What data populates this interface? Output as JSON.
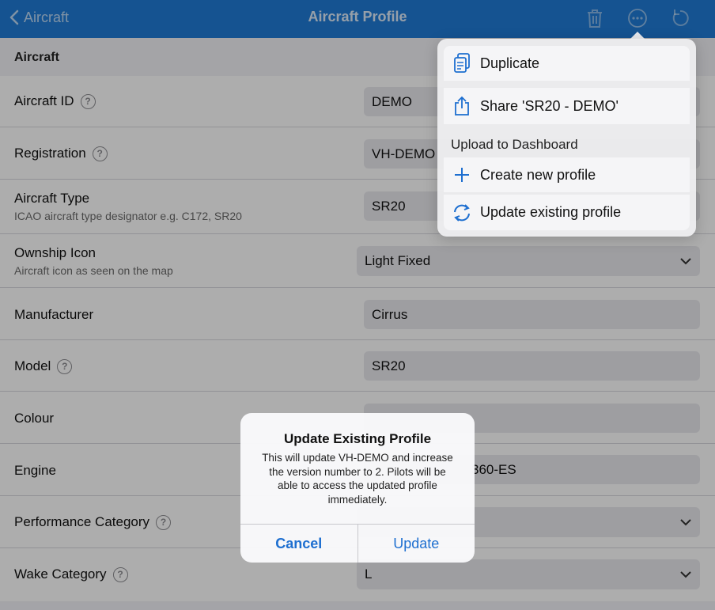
{
  "nav": {
    "back_label": "Aircraft",
    "title": "Aircraft Profile",
    "actions": [
      "trash-icon",
      "more-icon",
      "undo-icon"
    ]
  },
  "section": {
    "title": "Aircraft"
  },
  "rows": {
    "aircraft_id": {
      "label": "Aircraft ID",
      "value": "DEMO"
    },
    "registration": {
      "label": "Registration",
      "value": "VH-DEMO"
    },
    "aircraft_type": {
      "label": "Aircraft Type",
      "sublabel": "ICAO aircraft type designator e.g. C172, SR20",
      "value": "SR20"
    },
    "ownship_icon": {
      "label": "Ownship Icon",
      "sublabel": "Aircraft icon as seen on the map",
      "value": "Light Fixed"
    },
    "manufacturer": {
      "label": "Manufacturer",
      "value": "Cirrus"
    },
    "model": {
      "label": "Model",
      "value": "SR20"
    },
    "colour": {
      "label": "Colour",
      "value": ""
    },
    "engine": {
      "label": "Engine",
      "value": "360-ES"
    },
    "performance_category": {
      "label": "Performance Category",
      "value": ""
    },
    "wake_category": {
      "label": "Wake Category",
      "value": "L"
    }
  },
  "menu": {
    "duplicate": "Duplicate",
    "share": "Share 'SR20  - DEMO'",
    "upload_section": "Upload to Dashboard",
    "create_new": "Create new profile",
    "update_existing": "Update existing profile"
  },
  "alert": {
    "title": "Update Existing Profile",
    "message": "This will update VH-DEMO and increase the version number to 2. Pilots will be able to access the updated profile immediately.",
    "cancel": "Cancel",
    "confirm": "Update"
  },
  "colors": {
    "nav_bar": "#1f7bd6",
    "accent": "#1e6fd0"
  }
}
